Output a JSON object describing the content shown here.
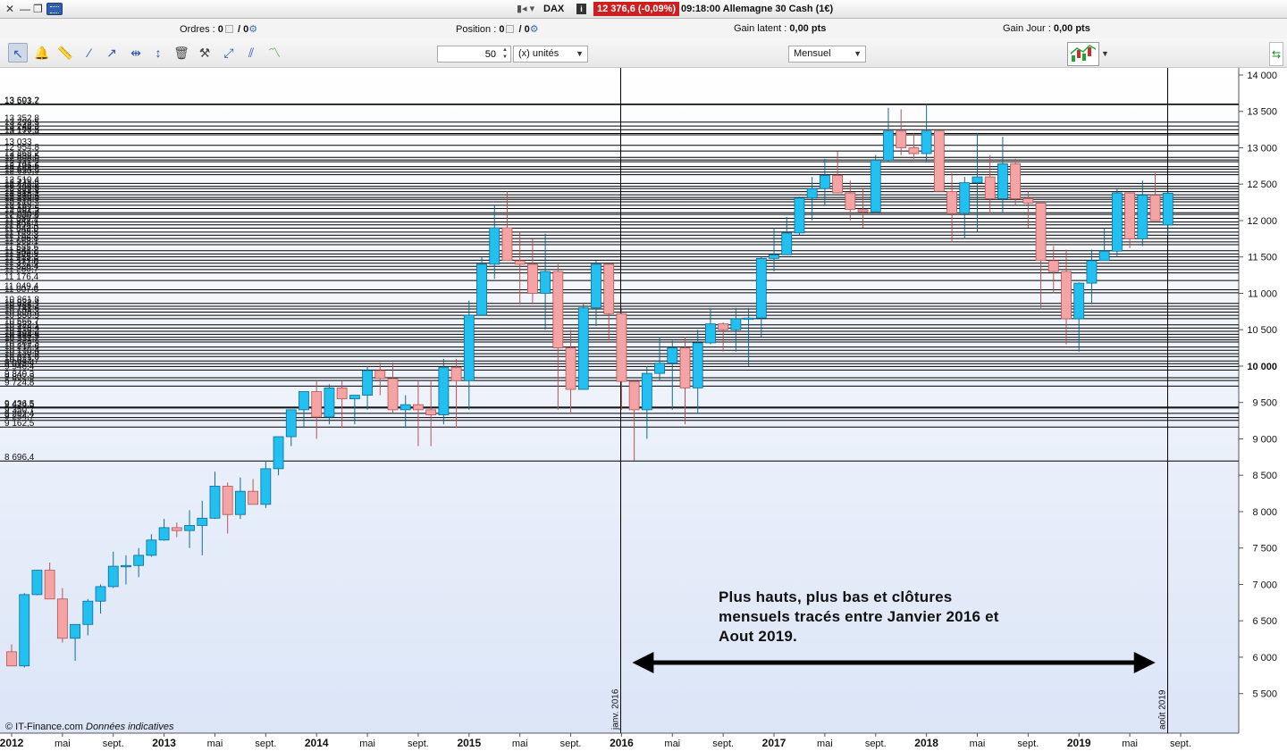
{
  "window": {
    "symbol": "DAX",
    "quote": "12 376,6 (-0,09%)",
    "quote_info": "09:18:00 Allemagne 30 Cash (1€)"
  },
  "infobar": {
    "orders_label": "Ordres :",
    "orders_value_a": "0",
    "orders_sep": "/ 0",
    "position_label": "Position :",
    "position_value_a": "0",
    "position_sep": "/ 0",
    "gain_latent_label": "Gain latent :",
    "gain_latent_value": "0,00 pts",
    "gain_jour_label": "Gain Jour :",
    "gain_jour_value": "0,00 pts"
  },
  "toolbar": {
    "quantity_value": "50",
    "unit_select": "(x) unités",
    "period_select": "Mensuel",
    "tools": [
      "cursor-icon",
      "alert-bell-icon",
      "ruler-icon",
      "line-icon",
      "trend-line-icon",
      "horizontal-line-icon",
      "vertical-line-icon",
      "trash-icon",
      "edit-tools-icon",
      "fibonacci-icon",
      "channel-icon",
      "indicator-icon"
    ]
  },
  "annotation": {
    "line1": "Plus hauts, plus bas et clôtures",
    "line2": "mensuels tracés entre Janvier 2016 et",
    "line3": "Aout 2019."
  },
  "copyright": "© IT-Finance.com",
  "copyright_note": "Données indicatives",
  "colors": {
    "up_fill": "#22c0f0",
    "up_stroke": "#0d6d95",
    "down_fill": "#f4a4a4",
    "down_stroke": "#b85252",
    "background_top": "#ffffff",
    "background_bottom": "#dbe5f7"
  },
  "chart_data": {
    "type": "candlestick",
    "period": "monthly",
    "ylim": [
      5300,
      14000
    ],
    "y_ticks": [
      {
        "value": 14000,
        "label": "14 000",
        "bold": false
      },
      {
        "value": 13500,
        "label": "13 500",
        "bold": false
      },
      {
        "value": 13000,
        "label": "13 000",
        "bold": false
      },
      {
        "value": 12500,
        "label": "12 500",
        "bold": false
      },
      {
        "value": 12000,
        "label": "12 000",
        "bold": false
      },
      {
        "value": 11500,
        "label": "11 500",
        "bold": false
      },
      {
        "value": 11000,
        "label": "11 000",
        "bold": false
      },
      {
        "value": 10500,
        "label": "10 500",
        "bold": false
      },
      {
        "value": 10000,
        "label": "10 000",
        "bold": true
      },
      {
        "value": 9500,
        "label": "9 500",
        "bold": false
      },
      {
        "value": 9000,
        "label": "9 000",
        "bold": false
      },
      {
        "value": 8500,
        "label": "8 500",
        "bold": false
      },
      {
        "value": 8000,
        "label": "8 000",
        "bold": false
      },
      {
        "value": 7500,
        "label": "7 500",
        "bold": false
      },
      {
        "value": 7000,
        "label": "7 000",
        "bold": false
      },
      {
        "value": 6500,
        "label": "6 500",
        "bold": false
      },
      {
        "value": 6000,
        "label": "6 000",
        "bold": false
      },
      {
        "value": 5500,
        "label": "5 500",
        "bold": false
      }
    ],
    "x_labels": [
      {
        "idx": 0,
        "label": "2012",
        "bold": true
      },
      {
        "idx": 4,
        "label": "mai",
        "bold": false
      },
      {
        "idx": 8,
        "label": "sept.",
        "bold": false
      },
      {
        "idx": 12,
        "label": "2013",
        "bold": true
      },
      {
        "idx": 16,
        "label": "mai",
        "bold": false
      },
      {
        "idx": 20,
        "label": "sept.",
        "bold": false
      },
      {
        "idx": 24,
        "label": "2014",
        "bold": true
      },
      {
        "idx": 28,
        "label": "mai",
        "bold": false
      },
      {
        "idx": 32,
        "label": "sept.",
        "bold": false
      },
      {
        "idx": 36,
        "label": "2015",
        "bold": true
      },
      {
        "idx": 40,
        "label": "mai",
        "bold": false
      },
      {
        "idx": 44,
        "label": "sept.",
        "bold": false
      },
      {
        "idx": 48,
        "label": "2016",
        "bold": true
      },
      {
        "idx": 52,
        "label": "mai",
        "bold": false
      },
      {
        "idx": 56,
        "label": "sept.",
        "bold": false
      },
      {
        "idx": 60,
        "label": "2017",
        "bold": true
      },
      {
        "idx": 64,
        "label": "mai",
        "bold": false
      },
      {
        "idx": 68,
        "label": "sept.",
        "bold": false
      },
      {
        "idx": 72,
        "label": "2018",
        "bold": true
      },
      {
        "idx": 76,
        "label": "mai",
        "bold": false
      },
      {
        "idx": 80,
        "label": "sept.",
        "bold": false
      },
      {
        "idx": 84,
        "label": "2019",
        "bold": true
      },
      {
        "idx": 88,
        "label": "mai",
        "bold": false
      },
      {
        "idx": 92,
        "label": "sept.",
        "bold": false
      }
    ],
    "candles": [
      [
        6075,
        6175,
        5900,
        5880
      ],
      [
        5880,
        6880,
        5860,
        6860
      ],
      [
        6860,
        7200,
        6850,
        7195
      ],
      [
        7195,
        7300,
        6800,
        6800
      ],
      [
        6800,
        6950,
        6200,
        6260
      ],
      [
        6260,
        6450,
        5950,
        6450
      ],
      [
        6450,
        6800,
        6300,
        6770
      ],
      [
        6770,
        7000,
        6600,
        6970
      ],
      [
        6970,
        7450,
        6950,
        7250
      ],
      [
        7250,
        7400,
        7000,
        7260
      ],
      [
        7260,
        7500,
        7100,
        7400
      ],
      [
        7400,
        7690,
        7380,
        7610
      ],
      [
        7610,
        7900,
        7600,
        7780
      ],
      [
        7780,
        7850,
        7650,
        7740
      ],
      [
        7740,
        8020,
        7500,
        7810
      ],
      [
        7810,
        8150,
        7400,
        7910
      ],
      [
        7910,
        8550,
        7900,
        8350
      ],
      [
        8350,
        8400,
        7700,
        7960
      ],
      [
        7960,
        8470,
        7900,
        8280
      ],
      [
        8280,
        8450,
        8100,
        8100
      ],
      [
        8100,
        8700,
        8050,
        8590
      ],
      [
        8590,
        9000,
        8500,
        9030
      ],
      [
        9030,
        9400,
        8900,
        9400
      ],
      [
        9400,
        9650,
        9150,
        9650
      ],
      [
        9650,
        9800,
        9000,
        9300
      ],
      [
        9300,
        9750,
        9200,
        9700
      ],
      [
        9700,
        9800,
        9150,
        9550
      ],
      [
        9550,
        9600,
        9200,
        9600
      ],
      [
        9600,
        10000,
        9400,
        9940
      ],
      [
        9940,
        10050,
        9600,
        9830
      ],
      [
        9830,
        10050,
        9350,
        9400
      ],
      [
        9400,
        9600,
        9150,
        9470
      ],
      [
        9470,
        9800,
        8900,
        9400
      ],
      [
        9400,
        9800,
        8900,
        9330
      ],
      [
        9330,
        10100,
        9200,
        9980
      ],
      [
        9980,
        10100,
        9150,
        9800
      ],
      [
        9800,
        10900,
        9400,
        10700
      ],
      [
        10700,
        11500,
        10700,
        11400
      ],
      [
        11400,
        12220,
        11200,
        11900
      ],
      [
        11900,
        12400,
        11500,
        11450
      ],
      [
        11450,
        11850,
        10850,
        11400
      ],
      [
        11400,
        11750,
        10850,
        11000
      ],
      [
        11000,
        11820,
        10500,
        11300
      ],
      [
        11300,
        11400,
        9400,
        10250
      ],
      [
        10250,
        10500,
        9340,
        9680
      ],
      [
        9680,
        10850,
        9700,
        10800
      ],
      [
        10800,
        11450,
        10550,
        11400
      ],
      [
        11400,
        11400,
        10350,
        10720
      ],
      [
        10720,
        10800,
        9400,
        9790
      ],
      [
        9790,
        9800,
        8700,
        9400
      ],
      [
        9400,
        10000,
        9000,
        9900
      ],
      [
        9900,
        10400,
        9800,
        10040
      ],
      [
        10040,
        10350,
        9400,
        10250
      ],
      [
        10250,
        10400,
        9200,
        9700
      ],
      [
        9700,
        10500,
        9350,
        10320
      ],
      [
        10320,
        10800,
        10300,
        10580
      ],
      [
        10580,
        10600,
        10200,
        10500
      ],
      [
        10500,
        10800,
        10200,
        10650
      ],
      [
        10650,
        10800,
        10000,
        10660
      ],
      [
        10660,
        11500,
        10400,
        11480
      ],
      [
        11480,
        11900,
        11300,
        11530
      ],
      [
        11530,
        12050,
        11700,
        11830
      ],
      [
        11830,
        12330,
        11800,
        12310
      ],
      [
        12310,
        12600,
        12000,
        12440
      ],
      [
        12440,
        12850,
        12200,
        12620
      ],
      [
        12620,
        12950,
        12400,
        12380
      ],
      [
        12380,
        12550,
        12000,
        12150
      ],
      [
        12150,
        12450,
        11900,
        12120
      ],
      [
        12120,
        12900,
        12100,
        12830
      ],
      [
        12830,
        13550,
        12800,
        13230
      ],
      [
        13230,
        13530,
        12900,
        13000
      ],
      [
        13000,
        13200,
        12850,
        12920
      ],
      [
        12920,
        13600,
        12800,
        13230
      ],
      [
        13230,
        13200,
        12500,
        12400
      ],
      [
        12400,
        12650,
        11700,
        12100
      ],
      [
        12100,
        12600,
        11750,
        12520
      ],
      [
        12520,
        13200,
        11850,
        12600
      ],
      [
        12600,
        12900,
        12100,
        12300
      ],
      [
        12300,
        13150,
        12100,
        12780
      ],
      [
        12780,
        12850,
        12200,
        12300
      ],
      [
        12300,
        12400,
        11900,
        12240
      ],
      [
        12240,
        12200,
        10800,
        11450
      ],
      [
        11450,
        11650,
        11000,
        11300
      ],
      [
        11300,
        11600,
        10300,
        10650
      ],
      [
        10650,
        11150,
        10200,
        11140
      ],
      [
        11140,
        11600,
        10850,
        11450
      ],
      [
        11450,
        11900,
        11500,
        11580
      ],
      [
        11580,
        12450,
        11500,
        12380
      ],
      [
        12380,
        12350,
        11620,
        11750
      ],
      [
        11750,
        12550,
        11650,
        12350
      ],
      [
        12350,
        12650,
        12000,
        12000
      ],
      [
        11940,
        12400,
        11800,
        12376
      ]
    ],
    "levels": [
      {
        "value": 13601.2,
        "label": "13 601,2"
      },
      {
        "value": 13593.7,
        "label": "13 593,7"
      },
      {
        "value": 13352.8,
        "label": "13 352,8"
      },
      {
        "value": 13299.5,
        "label": "13 299,5"
      },
      {
        "value": 13248.3,
        "label": "13 248,3"
      },
      {
        "value": 13196.5,
        "label": "13 196,5"
      },
      {
        "value": 13177.4,
        "label": "13 177,4"
      },
      {
        "value": 13033.0,
        "label": "13 033"
      },
      {
        "value": 12954.8,
        "label": "12 954,8"
      },
      {
        "value": 12868.2,
        "label": "12 868,2"
      },
      {
        "value": 12832.5,
        "label": "12 832,5"
      },
      {
        "value": 12808.0,
        "label": "12 808,0"
      },
      {
        "value": 12741.2,
        "label": "12 741,2"
      },
      {
        "value": 12706.6,
        "label": "12 706,6"
      },
      {
        "value": 12664.8,
        "label": "12 664,8"
      },
      {
        "value": 12630.9,
        "label": "12 630,9"
      },
      {
        "value": 12510.4,
        "label": "12 510,4"
      },
      {
        "value": 12471.5,
        "label": "12 471,5"
      },
      {
        "value": 12440.2,
        "label": "12 440,2"
      },
      {
        "value": 12396.8,
        "label": "12 396,8"
      },
      {
        "value": 12354.4,
        "label": "12 354,4"
      },
      {
        "value": 12318.1,
        "label": "12 318,1"
      },
      {
        "value": 12290.6,
        "label": "12 290,6"
      },
      {
        "value": 12258.3,
        "label": "12 258,3"
      },
      {
        "value": 12210.7,
        "label": "12 210,7"
      },
      {
        "value": 12165.2,
        "label": "12 165,2"
      },
      {
        "value": 12107.5,
        "label": "12 107,5"
      },
      {
        "value": 12084.3,
        "label": "12 084,3"
      },
      {
        "value": 12030.6,
        "label": "12 030,6"
      },
      {
        "value": 11980.2,
        "label": "11 980,2"
      },
      {
        "value": 11941.7,
        "label": "11 941,7"
      },
      {
        "value": 11895.4,
        "label": "11 895,4"
      },
      {
        "value": 11842.0,
        "label": "11 842,0"
      },
      {
        "value": 11798.6,
        "label": "11 798,6"
      },
      {
        "value": 11752.3,
        "label": "11 752,3"
      },
      {
        "value": 11706.8,
        "label": "11 706,8"
      },
      {
        "value": 11668.1,
        "label": "11 668,1"
      },
      {
        "value": 11585.6,
        "label": "11 585,6"
      },
      {
        "value": 11541.2,
        "label": "11 541,2"
      },
      {
        "value": 11500.9,
        "label": "11 500,9"
      },
      {
        "value": 11455.3,
        "label": "11 455,3"
      },
      {
        "value": 11414.6,
        "label": "11 414,6"
      },
      {
        "value": 11371.0,
        "label": "11 371,0"
      },
      {
        "value": 11326.4,
        "label": "11 326,4"
      },
      {
        "value": 11280.7,
        "label": "11 280,7"
      },
      {
        "value": 11176.4,
        "label": "11 176,4"
      },
      {
        "value": 11049.4,
        "label": "11 049,4"
      },
      {
        "value": 11007.6,
        "label": "11 007,6"
      },
      {
        "value": 10861.8,
        "label": "10 861,8"
      },
      {
        "value": 10822.4,
        "label": "10 822,4"
      },
      {
        "value": 10785.2,
        "label": "10 785,2"
      },
      {
        "value": 10741.6,
        "label": "10 741,6"
      },
      {
        "value": 10698.3,
        "label": "10 698,3"
      },
      {
        "value": 10650.9,
        "label": "10 650,9"
      },
      {
        "value": 10566.7,
        "label": "10 566,7"
      },
      {
        "value": 10522.1,
        "label": "10 522,1"
      },
      {
        "value": 10478.4,
        "label": "10 478,4"
      },
      {
        "value": 10436.2,
        "label": "10 436,2"
      },
      {
        "value": 10394.8,
        "label": "10 394,8"
      },
      {
        "value": 10360.5,
        "label": "10 360,5"
      },
      {
        "value": 10331.7,
        "label": "10 331,7"
      },
      {
        "value": 10262.3,
        "label": "10 262,3"
      },
      {
        "value": 10217.6,
        "label": "10 217,6"
      },
      {
        "value": 10170.4,
        "label": "10 170,4"
      },
      {
        "value": 10130.9,
        "label": "10 130,9"
      },
      {
        "value": 10071.0,
        "label": "10 071,0"
      },
      {
        "value": 10032.7,
        "label": "10 032,7"
      },
      {
        "value": 9995.4,
        "label": "9 995,4"
      },
      {
        "value": 9946.4,
        "label": "9 946,4"
      },
      {
        "value": 9840.3,
        "label": "9 840,3"
      },
      {
        "value": 9802.5,
        "label": "9 802,5"
      },
      {
        "value": 9724.8,
        "label": "9 724,8"
      },
      {
        "value": 9436.5,
        "label": "9 436,5"
      },
      {
        "value": 9424.5,
        "label": "9 424,5"
      },
      {
        "value": 9350.7,
        "label": "9 350,7"
      },
      {
        "value": 9292.4,
        "label": "9 292,4"
      },
      {
        "value": 9254.7,
        "label": "9 254,7"
      },
      {
        "value": 9162.5,
        "label": "9 162,5"
      },
      {
        "value": 8696.4,
        "label": "8 696,4"
      }
    ],
    "markers": [
      {
        "idx": 48,
        "label": "janv. 2016"
      },
      {
        "idx": 91,
        "label": "août 2019"
      }
    ],
    "arrow": {
      "from_idx": 48,
      "to_idx": 91,
      "value": 6000
    }
  }
}
